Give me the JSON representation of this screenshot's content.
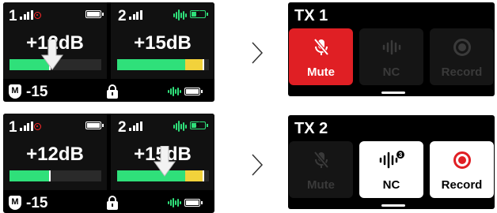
{
  "colors": {
    "accent_green": "#2fe07a",
    "rec_red": "#ff2a2a",
    "mute_red": "#e01f24",
    "meter_yellow": "#f2d23b"
  },
  "top": {
    "left": {
      "tx1": {
        "num": "1",
        "gain": "+12dB",
        "level": 0.45
      },
      "tx2": {
        "num": "2",
        "gain": "+15dB",
        "level": 0.9
      },
      "status": {
        "shield_icon": "M",
        "volume": "-15"
      }
    },
    "right": {
      "title": "TX 1",
      "tiles": [
        {
          "label": "Mute",
          "state": "active"
        },
        {
          "label": "NC",
          "state": "disabled"
        },
        {
          "label": "Record",
          "state": "disabled"
        }
      ]
    }
  },
  "bottom": {
    "left": {
      "tx1": {
        "num": "1",
        "gain": "+12dB",
        "level": 0.45
      },
      "tx2": {
        "num": "2",
        "gain": "+15dB",
        "level": 0.9
      },
      "status": {
        "shield_icon": "M",
        "volume": "-15"
      }
    },
    "right": {
      "title": "TX 2",
      "tiles": [
        {
          "label": "Mute",
          "state": "disabled"
        },
        {
          "label": "NC",
          "state": "on",
          "nc_level": "3"
        },
        {
          "label": "Record",
          "state": "on"
        }
      ]
    }
  }
}
